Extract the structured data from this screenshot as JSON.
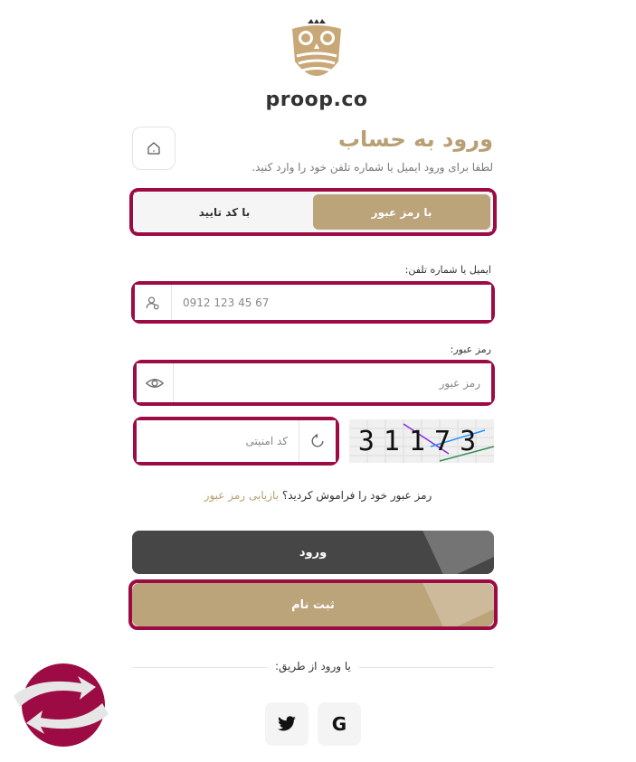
{
  "brand": {
    "name": "proop.co"
  },
  "header": {
    "title": "ورود به حساب",
    "subtitle": "لطفا برای ورود ایمیل یا شماره تلفن خود را وارد کنید."
  },
  "tabs": [
    {
      "label": "با رمز عبور",
      "active": true
    },
    {
      "label": "با کد تایید",
      "active": false
    }
  ],
  "form": {
    "phone_label": "ایمیل یا شماره تلفن:",
    "phone_value": "0912 123 45 67",
    "password_label": "رمز عبور:",
    "password_placeholder": "رمز عبور",
    "captcha_placeholder": "کد امنیتی",
    "captcha_text": "31173"
  },
  "forgot": {
    "text": "رمز عبور خود را فراموش کردید؟",
    "link": "بازیابی رمز عبور"
  },
  "buttons": {
    "login": "ورود",
    "register": "ثبت نام"
  },
  "social": {
    "divider_text": "یا ورود از طریق:",
    "items": [
      "twitter-icon",
      "google-icon"
    ]
  },
  "colors": {
    "accent": "#bba37a",
    "highlight": "#9c0b43",
    "dark_button": "#464646"
  }
}
